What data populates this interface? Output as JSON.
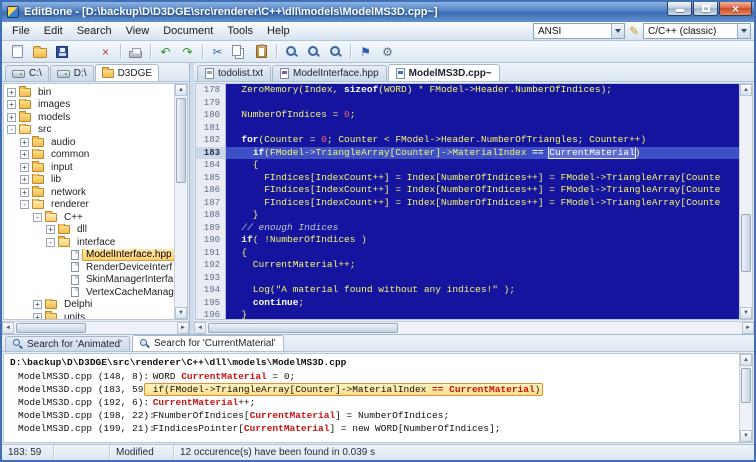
{
  "window": {
    "title": "EditBone - [D:\\backup\\D\\D3DGE\\src\\renderer\\C++\\dll\\models\\ModelMS3D.cpp~]"
  },
  "menubar": {
    "items": [
      "File",
      "Edit",
      "Search",
      "View",
      "Document",
      "Tools",
      "Help"
    ],
    "encoding": "ANSI",
    "syntax": "C/C++ (classic)"
  },
  "toolbar": {
    "groups": [
      [
        {
          "name": "new-file-button",
          "shape": "sheet"
        },
        {
          "name": "open-file-button",
          "shape": "folder"
        },
        {
          "name": "save-button",
          "shape": "floppy"
        },
        {
          "name": "save-all-button",
          "shape": "floppy2"
        },
        {
          "name": "close-file-button",
          "glyph": "×",
          "color": "#c0392b"
        }
      ],
      [
        {
          "name": "print-button",
          "shape": "printer"
        }
      ],
      [
        {
          "name": "undo-button",
          "glyph": "↶",
          "color": "#2f8f2f"
        },
        {
          "name": "redo-button",
          "glyph": "↷",
          "color": "#2f8f2f"
        }
      ],
      [
        {
          "name": "cut-button",
          "glyph": "✂",
          "color": "#44699d"
        },
        {
          "name": "copy-button",
          "shape": "copy"
        },
        {
          "name": "paste-button",
          "shape": "paste"
        }
      ],
      [
        {
          "name": "find-button",
          "shape": "mag"
        },
        {
          "name": "find-next-button",
          "shape": "mag"
        },
        {
          "name": "replace-button",
          "shape": "mag"
        }
      ],
      [
        {
          "name": "bookmark-button",
          "glyph": "⚑",
          "color": "#2a5db0"
        },
        {
          "name": "options-button",
          "glyph": "⚙",
          "color": "#5a6a7a"
        }
      ]
    ]
  },
  "explorer": {
    "tabs": [
      {
        "label": "C:\\",
        "icon": "drive",
        "active": false
      },
      {
        "label": "D:\\",
        "icon": "drive",
        "active": false
      },
      {
        "label": "D3DGE",
        "icon": "folder",
        "active": true
      }
    ],
    "items": [
      {
        "label": "bin",
        "depth": 0,
        "toggle": "+",
        "icon": "folder"
      },
      {
        "label": "images",
        "depth": 0,
        "toggle": "+",
        "icon": "folder"
      },
      {
        "label": "models",
        "depth": 0,
        "toggle": "+",
        "icon": "folder"
      },
      {
        "label": "src",
        "depth": 0,
        "toggle": "-",
        "icon": "folder-open"
      },
      {
        "label": "audio",
        "depth": 1,
        "toggle": "+",
        "icon": "folder"
      },
      {
        "label": "common",
        "depth": 1,
        "toggle": "+",
        "icon": "folder"
      },
      {
        "label": "input",
        "depth": 1,
        "toggle": "+",
        "icon": "folder"
      },
      {
        "label": "lib",
        "depth": 1,
        "toggle": "+",
        "icon": "folder"
      },
      {
        "label": "network",
        "depth": 1,
        "toggle": "+",
        "icon": "folder"
      },
      {
        "label": "renderer",
        "depth": 1,
        "toggle": "-",
        "icon": "folder-open"
      },
      {
        "label": "C++",
        "depth": 2,
        "toggle": "-",
        "icon": "folder-open"
      },
      {
        "label": "dll",
        "depth": 3,
        "toggle": "+",
        "icon": "folder"
      },
      {
        "label": "interface",
        "depth": 3,
        "toggle": "-",
        "icon": "folder-open"
      },
      {
        "label": "ModelInterface.hpp",
        "depth": 4,
        "icon": "file",
        "selected": true
      },
      {
        "label": "RenderDeviceInterf",
        "depth": 4,
        "icon": "file"
      },
      {
        "label": "SkinManagerInterfa",
        "depth": 4,
        "icon": "file"
      },
      {
        "label": "VertexCacheManag",
        "depth": 4,
        "icon": "file"
      },
      {
        "label": "Delphi",
        "depth": 2,
        "toggle": "+",
        "icon": "folder"
      },
      {
        "label": "units",
        "depth": 2,
        "toggle": "+",
        "icon": "folder"
      }
    ]
  },
  "editor": {
    "tabs": [
      {
        "label": "todolist.txt",
        "dot": "#9aa2ae",
        "active": false
      },
      {
        "label": "ModelInterface.hpp",
        "dot": "#7a5fb8",
        "active": false
      },
      {
        "label": "ModelMS3D.cpp~",
        "dot": "#3a6fd0",
        "active": true
      }
    ],
    "active_line": 183,
    "lines": [
      {
        "n": 178,
        "tok": [
          [
            "t",
            "  ZeroMemory(Index, "
          ],
          [
            "k",
            "sizeof"
          ],
          [
            "t",
            "(WORD) * FModel->Header.NumberOfIndices);"
          ]
        ]
      },
      {
        "n": 179,
        "tok": []
      },
      {
        "n": 180,
        "tok": [
          [
            "t",
            "  NumberOfIndices = "
          ],
          [
            "n",
            "0"
          ],
          [
            "t",
            ";"
          ]
        ]
      },
      {
        "n": 181,
        "tok": []
      },
      {
        "n": 182,
        "tok": [
          [
            "t",
            "  "
          ],
          [
            "k",
            "for"
          ],
          [
            "t",
            "(Counter = "
          ],
          [
            "n",
            "0"
          ],
          [
            "t",
            "; Counter < FModel->Header.NumberOfTriangles; Counter++)"
          ]
        ]
      },
      {
        "n": 183,
        "tok": [
          [
            "t",
            "    "
          ],
          [
            "k",
            "if"
          ],
          [
            "t",
            "(FModel->TriangleArray[Counter]->MaterialIndex "
          ],
          [
            "k",
            "=="
          ],
          [
            "t",
            " "
          ],
          [
            "m",
            "CurrentMaterial"
          ],
          [
            "t",
            ")"
          ]
        ]
      },
      {
        "n": 184,
        "tok": [
          [
            "t",
            "    {"
          ]
        ]
      },
      {
        "n": 185,
        "tok": [
          [
            "t",
            "      FIndices[IndexCount++] = Index[NumberOfIndices++] = FModel->TriangleArray[Counte"
          ]
        ]
      },
      {
        "n": 186,
        "tok": [
          [
            "t",
            "      FIndices[IndexCount++] = Index[NumberOfIndices++] = FModel->TriangleArray[Counte"
          ]
        ]
      },
      {
        "n": 187,
        "tok": [
          [
            "t",
            "      FIndices[IndexCount++] = Index[NumberOfIndices++] = FModel->TriangleArray[Counte"
          ]
        ]
      },
      {
        "n": 188,
        "tok": [
          [
            "t",
            "    }"
          ]
        ]
      },
      {
        "n": 189,
        "tok": [
          [
            "c",
            "  // enough Indices"
          ]
        ]
      },
      {
        "n": 190,
        "tok": [
          [
            "t",
            "  "
          ],
          [
            "k",
            "if"
          ],
          [
            "t",
            "( !NumberOfIndices )"
          ]
        ]
      },
      {
        "n": 191,
        "tok": [
          [
            "t",
            "  {"
          ]
        ]
      },
      {
        "n": 192,
        "tok": [
          [
            "t",
            "    CurrentMaterial++;"
          ]
        ]
      },
      {
        "n": 193,
        "tok": []
      },
      {
        "n": 194,
        "tok": [
          [
            "t",
            "    Log("
          ],
          [
            "s",
            "\"A material found without any indices!\""
          ],
          [
            "t",
            " );"
          ]
        ]
      },
      {
        "n": 195,
        "tok": [
          [
            "t",
            "    "
          ],
          [
            "k",
            "continue"
          ],
          [
            "t",
            ";"
          ]
        ]
      },
      {
        "n": 196,
        "tok": [
          [
            "t",
            "  }"
          ]
        ]
      }
    ]
  },
  "search": {
    "tabs": [
      {
        "label": "Search for 'Animated'",
        "active": false
      },
      {
        "label": "Search for 'CurrentMaterial'",
        "active": true
      }
    ],
    "header": "D:\\backup\\D\\D3DGE\\src\\renderer\\C++\\dll\\models\\ModelMS3D.cpp",
    "results": [
      {
        "loc": "ModelMS3D.cpp (148, 8):",
        "active": false,
        "seg": [
          [
            "t",
            " WORD "
          ],
          [
            "m",
            "CurrentMaterial"
          ],
          [
            "t",
            " = 0;"
          ]
        ]
      },
      {
        "loc": "ModelMS3D.cpp (183, 59):",
        "active": true,
        "seg": [
          [
            "t",
            " if(FModel->TriangleArray[Counter]->MaterialIndex "
          ],
          [
            "m",
            "== CurrentMaterial"
          ],
          [
            "t",
            ")"
          ]
        ]
      },
      {
        "loc": "ModelMS3D.cpp (192, 6):",
        "active": false,
        "seg": [
          [
            "t",
            " "
          ],
          [
            "m",
            "CurrentMaterial"
          ],
          [
            "t",
            "++;"
          ]
        ]
      },
      {
        "loc": "ModelMS3D.cpp (198, 22):",
        "active": false,
        "seg": [
          [
            "t",
            " FNumberOfIndices["
          ],
          [
            "m",
            "CurrentMaterial"
          ],
          [
            "t",
            "] = NumberOfIndices;"
          ]
        ]
      },
      {
        "loc": "ModelMS3D.cpp (199, 21):",
        "active": false,
        "seg": [
          [
            "t",
            " FIndicesPointer["
          ],
          [
            "m",
            "CurrentMaterial"
          ],
          [
            "t",
            "] = new WORD[NumberOfIndices];"
          ]
        ]
      }
    ]
  },
  "statusbar": {
    "cells": [
      "183: 59",
      "",
      "Modified",
      "12 occurence(s) have been found in 0.039 s"
    ]
  }
}
